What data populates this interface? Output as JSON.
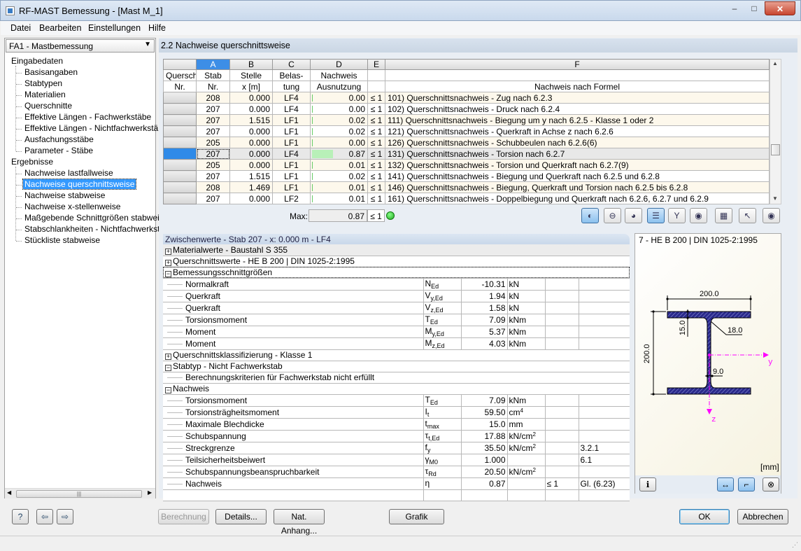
{
  "window": {
    "title": "RF-MAST Bemessung - [Mast M_1]",
    "minimize": "–",
    "maximize": "□",
    "close": "✕"
  },
  "menu": [
    "Datei",
    "Bearbeiten",
    "Einstellungen",
    "Hilfe"
  ],
  "case_select": {
    "value": "FA1 - Mastbemessung"
  },
  "tree": {
    "input_group": "Eingabedaten",
    "input_items": [
      "Basisangaben",
      "Stabtypen",
      "Materialien",
      "Querschnitte",
      "Effektive Längen - Fachwerkstäbe",
      "Effektive Längen - Nichtfachwerkstäbe",
      "Ausfachungsstäbe",
      "Parameter - Stäbe"
    ],
    "results_group": "Ergebnisse",
    "results_items": [
      "Nachweise lastfallweise",
      "Nachweise querschnittsweise",
      "Nachweise stabweise",
      "Nachweise x-stellenweise",
      "Maßgebende Schnittgrößen stabweise",
      "Stabschlankheiten - Nichtfachwerkstäb",
      "Stückliste stabweise"
    ],
    "selected_index": 1
  },
  "section_title": "2.2 Nachweise querschnittsweise",
  "table": {
    "letters": [
      "A",
      "B",
      "C",
      "D",
      "E",
      "F"
    ],
    "headers": {
      "rowhead": [
        "Quersch.",
        "Nr."
      ],
      "A": [
        "Stab",
        "Nr."
      ],
      "B": [
        "Stelle",
        "x [m]"
      ],
      "C": [
        "Belas-",
        "tung"
      ],
      "D": [
        "Nachweis",
        "Ausnutzung"
      ],
      "E": [
        "",
        ""
      ],
      "F": [
        "",
        "Nachweis nach Formel"
      ]
    },
    "rows": [
      {
        "stab": "208",
        "x": "0.000",
        "lf": "LF4",
        "util": "0.00",
        "le": "≤ 1",
        "formula": "101) Querschnittsnachweis - Zug nach 6.2.3"
      },
      {
        "stab": "207",
        "x": "0.000",
        "lf": "LF4",
        "util": "0.00",
        "le": "≤ 1",
        "formula": "102) Querschnittsnachweis - Druck nach 6.2.4"
      },
      {
        "stab": "207",
        "x": "1.515",
        "lf": "LF1",
        "util": "0.02",
        "le": "≤ 1",
        "formula": "111) Querschnittsnachweis - Biegung um y nach 6.2.5 - Klasse 1 oder 2"
      },
      {
        "stab": "207",
        "x": "0.000",
        "lf": "LF1",
        "util": "0.02",
        "le": "≤ 1",
        "formula": "121) Querschnittsnachweis - Querkraft in Achse z nach 6.2.6"
      },
      {
        "stab": "205",
        "x": "0.000",
        "lf": "LF1",
        "util": "0.00",
        "le": "≤ 1",
        "formula": "126) Querschnittsnachweis - Schubbeulen nach 6.2.6(6)"
      },
      {
        "stab": "207",
        "x": "0.000",
        "lf": "LF4",
        "util": "0.87",
        "le": "≤ 1",
        "formula": "131) Querschnittsnachweis - Torsion nach 6.2.7"
      },
      {
        "stab": "205",
        "x": "0.000",
        "lf": "LF1",
        "util": "0.01",
        "le": "≤ 1",
        "formula": "132) Querschnittsnachweis - Torsion und Querkraft nach 6.2.7(9)"
      },
      {
        "stab": "207",
        "x": "1.515",
        "lf": "LF1",
        "util": "0.02",
        "le": "≤ 1",
        "formula": "141) Querschnittsnachweis - Biegung und Querkraft nach 6.2.5 und 6.2.8"
      },
      {
        "stab": "208",
        "x": "1.469",
        "lf": "LF1",
        "util": "0.01",
        "le": "≤ 1",
        "formula": "146) Querschnittsnachweis - Biegung, Querkraft und Torsion nach 6.2.5 bis 6.2.8"
      },
      {
        "stab": "207",
        "x": "0.000",
        "lf": "LF2",
        "util": "0.01",
        "le": "≤ 1",
        "formula": "161) Querschnittsnachweis - Doppelbiegung und Querkraft nach 6.2.6, 6.2.7 und 6.2.9"
      }
    ],
    "selected_row": 5,
    "max_label": "Max:",
    "max_value": "0.87",
    "max_le": "≤ 1",
    "status_icon": "ok-smiley-icon",
    "toolbar_icons": [
      "result-diagram-icon",
      "section-view-icon",
      "color-relief-icon",
      "utilization-bars-icon",
      "filter-greater-one-icon",
      "view-mode-icon",
      "excel-export-icon",
      "select-pointer-icon",
      "visibility-eye-icon"
    ]
  },
  "details": {
    "title": "Zwischenwerte - Stab 207 - x: 0.000 m - LF4",
    "rows": [
      {
        "type": "group",
        "sign": "+",
        "label": "Materialwerte - Baustahl S 355"
      },
      {
        "type": "group",
        "sign": "+",
        "label": "Querschnittswerte  -  HE B 200 | DIN 1025-2:1995"
      },
      {
        "type": "group",
        "sign": "−",
        "label": "Bemessungsschnittgrößen"
      },
      {
        "type": "item",
        "label": "Normalkraft",
        "sym": "N",
        "sub": "Ed",
        "val": "-10.31",
        "unit": "kN",
        "sup": "",
        "le": "",
        "ref": ""
      },
      {
        "type": "item",
        "label": "Querkraft",
        "sym": "V",
        "sub": "y,Ed",
        "val": "1.94",
        "unit": "kN",
        "sup": "",
        "le": "",
        "ref": ""
      },
      {
        "type": "item",
        "label": "Querkraft",
        "sym": "V",
        "sub": "z,Ed",
        "val": "1.58",
        "unit": "kN",
        "sup": "",
        "le": "",
        "ref": ""
      },
      {
        "type": "item",
        "label": "Torsionsmoment",
        "sym": "T",
        "sub": "Ed",
        "val": "7.09",
        "unit": "kNm",
        "sup": "",
        "le": "",
        "ref": ""
      },
      {
        "type": "item",
        "label": "Moment",
        "sym": "M",
        "sub": "y,Ed",
        "val": "5.37",
        "unit": "kNm",
        "sup": "",
        "le": "",
        "ref": ""
      },
      {
        "type": "item",
        "label": "Moment",
        "sym": "M",
        "sub": "z,Ed",
        "val": "4.03",
        "unit": "kNm",
        "sup": "",
        "le": "",
        "ref": ""
      },
      {
        "type": "group",
        "sign": "+",
        "label": "Querschnittsklassifizierung - Klasse 1"
      },
      {
        "type": "group",
        "sign": "−",
        "label": "Stabtyp - Nicht Fachwerkstab"
      },
      {
        "type": "text",
        "label": "Berechnungskriterien für Fachwerkstab nicht erfüllt"
      },
      {
        "type": "group",
        "sign": "−",
        "label": "Nachweis"
      },
      {
        "type": "item",
        "label": "Torsionsmoment",
        "sym": "T",
        "sub": "Ed",
        "val": "7.09",
        "unit": "kNm",
        "sup": "",
        "le": "",
        "ref": ""
      },
      {
        "type": "item",
        "label": "Torsionsträgheitsmoment",
        "sym": "I",
        "sub": "t",
        "val": "59.50",
        "unit": "cm",
        "sup": "4",
        "le": "",
        "ref": ""
      },
      {
        "type": "item",
        "label": "Maximale Blechdicke",
        "sym": "t",
        "sub": "max",
        "val": "15.0",
        "unit": "mm",
        "sup": "",
        "le": "",
        "ref": ""
      },
      {
        "type": "item",
        "label": "Schubspannung",
        "sym": "τ",
        "sub": "t,Ed",
        "val": "17.88",
        "unit": "kN/cm",
        "sup": "2",
        "le": "",
        "ref": ""
      },
      {
        "type": "item",
        "label": "Streckgrenze",
        "sym": "f",
        "sub": "y",
        "val": "35.50",
        "unit": "kN/cm",
        "sup": "2",
        "le": "",
        "ref": "3.2.1"
      },
      {
        "type": "item",
        "label": "Teilsicherheitsbeiwert",
        "sym": "γ",
        "sub": "M0",
        "val": "1.000",
        "unit": "",
        "sup": "",
        "le": "",
        "ref": "6.1"
      },
      {
        "type": "item",
        "label": "Schubspannungsbeanspruchbarkeit",
        "sym": "τ",
        "sub": "Rd",
        "val": "20.50",
        "unit": "kN/cm",
        "sup": "2",
        "le": "",
        "ref": ""
      },
      {
        "type": "item",
        "label": "Nachweis",
        "sym": "η",
        "sub": "",
        "val": "0.87",
        "unit": "",
        "sup": "",
        "le": "≤ 1",
        "ref": "Gl. (6.23)"
      },
      {
        "type": "blank"
      }
    ]
  },
  "graphic": {
    "title": "7 - HE B 200 | DIN 1025-2:1995",
    "dims": {
      "width": "200.0",
      "height": "200.0",
      "flange": "15.0",
      "radius": "18.0",
      "web": "9.0"
    },
    "axes": {
      "y": "y",
      "z": "z"
    },
    "unit": "[mm]",
    "section_fill": "#2a2a8c",
    "axis_color": "#ff00ff",
    "buttons": [
      "info-icon",
      "dimension-toggle-icon",
      "axis-toggle-icon",
      "zoom-reset-icon"
    ]
  },
  "buttons": {
    "help_icon": "help-icon",
    "prev_icon": "previous-icon",
    "next_icon": "next-icon",
    "calc": "Berechnung",
    "details": "Details...",
    "annex": "Nat. Anhang...",
    "graphic": "Grafik",
    "ok": "OK",
    "cancel": "Abbrechen"
  }
}
